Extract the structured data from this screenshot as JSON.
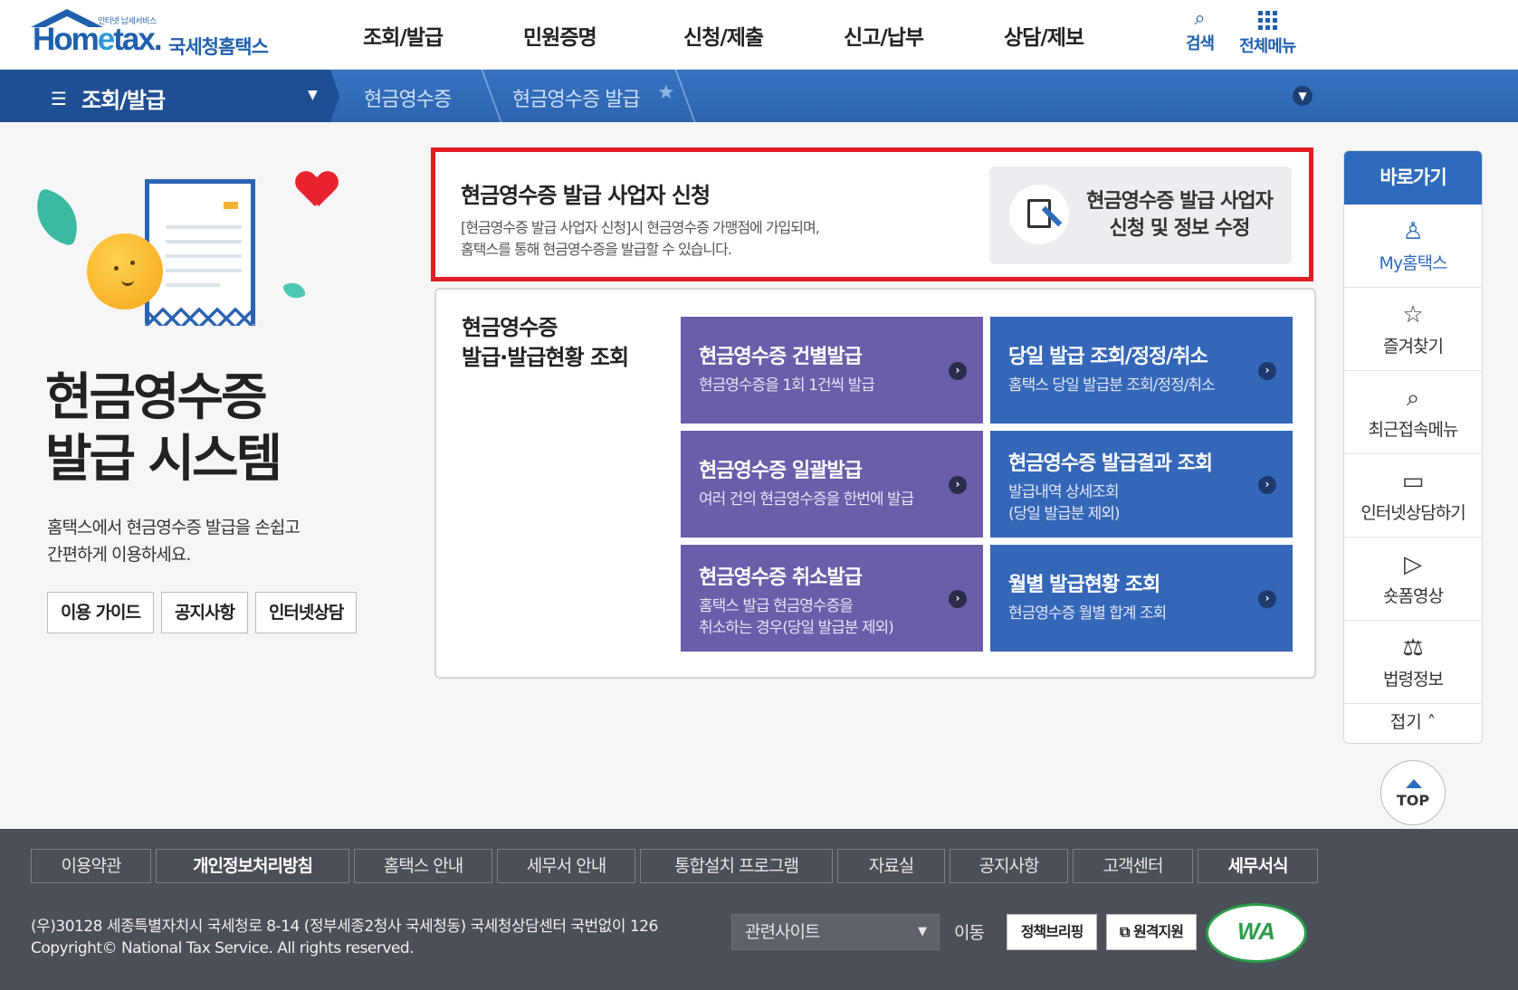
{
  "header": {
    "logo_tagline": "인터넷 납세서비스",
    "logo_word_pre": "Hom",
    "logo_word_e": "e",
    "logo_word_post": "tax.",
    "logo_kr": "국세청홈택스",
    "nav": [
      "조회/발급",
      "민원증명",
      "신청/제출",
      "신고/납부",
      "상담/제보"
    ],
    "search_label": "검색",
    "menu_label": "전체메뉴"
  },
  "breadcrumb": {
    "menu": "조회/발급",
    "steps": [
      "현금영수증",
      "현금영수증 발급"
    ]
  },
  "hero": {
    "title_line1": "현금영수증",
    "title_line2": "발급 시스템",
    "desc_line1": "홈택스에서 현금영수증 발급을 손쉽고",
    "desc_line2": "간편하게 이용하세요.",
    "buttons": [
      "이용 가이드",
      "공지사항",
      "인터넷상담"
    ]
  },
  "apply": {
    "title": "현금영수증 발급 사업자 신청",
    "desc_line1": "[현금영수증 발급 사업자 신청]시 현금영수증 가맹점에 가입되며,",
    "desc_line2": "홈택스를 통해 현금영수증을 발급할 수 있습니다.",
    "button_line1": "현금영수증 발급 사업자",
    "button_line2": "신청 및 정보 수정"
  },
  "query": {
    "title_line1": "현금영수증",
    "title_line2": "발급·발급현황 조회",
    "tiles": [
      {
        "title": "현금영수증 건별발급",
        "sub1": "현금영수증을 1회 1건씩 발급",
        "sub2": ""
      },
      {
        "title": "당일 발급 조회/정정/취소",
        "sub1": "홈택스 당일 발급분 조회/정정/취소",
        "sub2": ""
      },
      {
        "title": "현금영수증 일괄발급",
        "sub1": "여러 건의 현금영수증을 한번에 발급",
        "sub2": ""
      },
      {
        "title": "현금영수증 발급결과 조회",
        "sub1": "발급내역 상세조회",
        "sub2": "(당일 발급분 제외)"
      },
      {
        "title": "현금영수증 취소발급",
        "sub1": "홈택스 발급 현금영수증을",
        "sub2": "취소하는 경우(당일 발급분 제외)"
      },
      {
        "title": "월별 발급현황 조회",
        "sub1": "현금영수증 월별 합계 조회",
        "sub2": ""
      }
    ],
    "arrow": "›"
  },
  "quick": {
    "head": "바로가기",
    "items": [
      {
        "icon": "user-icon",
        "glyph": "♙",
        "label": "My홈택스"
      },
      {
        "icon": "star-icon",
        "glyph": "☆",
        "label": "즐겨찾기"
      },
      {
        "icon": "recent-search-icon",
        "glyph": "⌕",
        "label": "최근접속메뉴"
      },
      {
        "icon": "monitor-icon",
        "glyph": "▭",
        "label": "인터넷상담하기"
      },
      {
        "icon": "play-icon",
        "glyph": "▷",
        "label": "숏폼영상"
      },
      {
        "icon": "gavel-icon",
        "glyph": "⚖",
        "label": "법령정보"
      }
    ],
    "fold": "접기 ˄",
    "top": "TOP"
  },
  "footer": {
    "links": [
      "이용약관",
      "개인정보처리방침",
      "홈택스 안내",
      "세무서 안내",
      "통합설치 프로그램",
      "자료실",
      "공지사항",
      "고객센터",
      "세무서식"
    ],
    "address": "(우)30128 세종특별자치시 국세청로 8-14 (정부세종2청사 국세청동) 국세청상담센터 국번없이 126",
    "copyright": "Copyright© National Tax Service. All rights reserved.",
    "related_placeholder": "관련사이트",
    "go": "이동",
    "policy_briefing": "정책브리핑",
    "remote_support": "원격지원",
    "wa": "WA"
  },
  "colors": {
    "brand_blue": "#1f5fae",
    "highlight_red": "#e21b23",
    "tile_purple": "#6a5da9",
    "tile_blue": "#3467b8",
    "footer_gray": "#4b4f57"
  }
}
